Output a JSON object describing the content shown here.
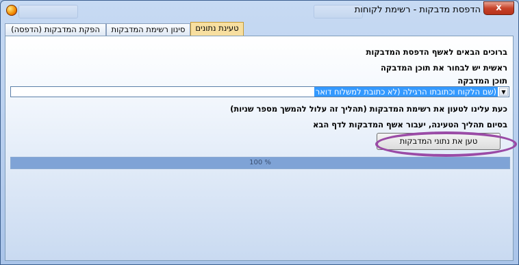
{
  "window": {
    "title": "הדפסת מדבקות - רשימת לקוחות",
    "close_label": "x"
  },
  "tabs": [
    {
      "label": "טעינת נתונים",
      "active": true
    },
    {
      "label": "סינון רשימת המדבקות",
      "active": false
    },
    {
      "label": "הפקת המדבקות (הדפסה)",
      "active": false
    }
  ],
  "main": {
    "welcome": "ברוכים הבאים לאשף הדפסת המדבקות",
    "first_step": "ראשית יש לבחור את תוכן המדבקה",
    "content_label": "תוכן המדבקה",
    "content_value": "(שם הלקוח וכתובתו הרגילה (לא כתובת למשלוח דואר",
    "now_load": "כעת עלינו לטעון את רשימת המדבקות (תהליך זה עלול להמשך מספר שניות)",
    "after_load": "בסיום תהליך הטעינה, יעבור אשף המדבקות לדף הבא",
    "load_button": "טען את נתוני המדבקות",
    "progress_text": "100 %",
    "progress_value": 100
  },
  "icons": {
    "app": "app-logo-icon",
    "dropdown": "chevron-down-icon"
  },
  "colors": {
    "active_tab": "#f7dfa0",
    "selection": "#3399ff",
    "highlight_ellipse": "#9a4ba6",
    "progress": "#7fa3d6",
    "close": "#c7432a"
  }
}
